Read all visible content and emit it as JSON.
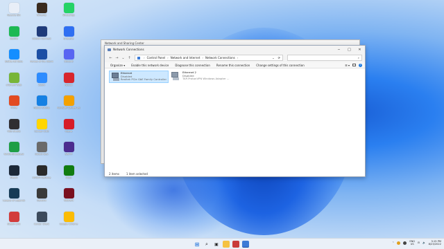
{
  "desktop_icons": [
    {
      "label": "Recycle Bin",
      "icon": "recycle-bin-icon",
      "color": "#e8eef7"
    },
    {
      "label": "Winamp",
      "icon": "winamp-icon",
      "color": "#3a2b1e"
    },
    {
      "label": "WhatsApp",
      "icon": "whatsapp-icon",
      "color": "#25d366"
    },
    {
      "label": "Spotify",
      "icon": "spotify-icon",
      "color": "#1db954"
    },
    {
      "label": "Ubisoft Connect",
      "icon": "ubisoft-icon",
      "color": "#1f3b7a"
    },
    {
      "label": "Snipaste",
      "icon": "snipaste-icon",
      "color": "#2f6ff2"
    },
    {
      "label": "Battle.net Beta",
      "icon": "battlenet-icon",
      "color": "#148eff"
    },
    {
      "label": "Heroes of the Storm",
      "icon": "hots-icon",
      "color": "#1c4fa5"
    },
    {
      "label": "Discord",
      "icon": "discord-icon",
      "color": "#5865f2"
    },
    {
      "label": "uTorrent Web",
      "icon": "utorrent-icon",
      "color": "#77b538"
    },
    {
      "label": "Zoom",
      "icon": "zoom-icon",
      "color": "#2d8cff"
    },
    {
      "label": "Roblox",
      "icon": "roblox-icon",
      "color": "#d8262d"
    },
    {
      "label": "Prime",
      "icon": "prime-icon",
      "color": "#e24a21"
    },
    {
      "label": "Roblox Studio",
      "icon": "roblox-studio-icon",
      "color": "#1580e3"
    },
    {
      "label": "Rockstar Games Launcher",
      "icon": "rockstar-icon",
      "color": "#f4a100"
    },
    {
      "label": "OBS Studio",
      "icon": "obs-icon",
      "color": "#302e31"
    },
    {
      "label": "Corsair iCUE",
      "icon": "icue-icon",
      "color": "#ffd600"
    },
    {
      "label": "Opera",
      "icon": "opera-icon",
      "color": "#d61c28"
    },
    {
      "label": "Nvidia Broadcast",
      "icon": "nvidia-broadcast-icon",
      "color": "#1e9e45"
    },
    {
      "label": "Ublock Dev",
      "icon": "ublock-icon",
      "color": "#6a6a6a"
    },
    {
      "label": "SWI-Pl",
      "icon": "swipl-icon",
      "color": "#4b2c8f"
    },
    {
      "label": "Steam",
      "icon": "steam-icon",
      "color": "#1b2838"
    },
    {
      "label": "NVIDIA GeForce",
      "icon": "nvidia-icon",
      "color": "#2a2a2a"
    },
    {
      "label": "Xbox",
      "icon": "xbox-icon",
      "color": "#107c10"
    },
    {
      "label": "League of Legends",
      "icon": "league-icon",
      "color": "#163b56"
    },
    {
      "label": "Genshin",
      "icon": "genshin-icon",
      "color": "#3a3a3a"
    },
    {
      "label": "Valorant",
      "icon": "valorant-icon",
      "color": "#7a1020"
    },
    {
      "label": "Steam Link",
      "icon": "steam-link-icon",
      "color": "#d23b3b"
    },
    {
      "label": "Cursor Client",
      "icon": "cursor-icon",
      "color": "#3c4a5c"
    },
    {
      "label": "Google Chrome",
      "icon": "chrome-icon",
      "color": "#fbbc05"
    }
  ],
  "back_window": {
    "title": "Network and Sharing Center"
  },
  "window": {
    "title": "Network Connections",
    "controls": {
      "minimize": "─",
      "maximize": "□",
      "close": "✕"
    },
    "nav": {
      "back": "←",
      "forward": "→",
      "recent": "⌄",
      "up": "↑"
    },
    "breadcrumb": [
      "Control Panel",
      "Network and Internet",
      "Network Connections"
    ],
    "search_icon": "⌕",
    "commands": [
      "Organize ▾",
      "Enable this network device",
      "Diagnose this connection",
      "Rename this connection",
      "Change settings of this connection"
    ],
    "items": [
      {
        "name": "Ethernet",
        "status": "Disabled",
        "device": "Realtek PCIe GbE Family Controller",
        "selected": true
      },
      {
        "name": "Ethernet 2",
        "status": "Disabled",
        "device": "TAP-ProtonVPN Windows Adapter ..."
      }
    ],
    "status": {
      "count": "2 items",
      "selected": "1 item selected"
    }
  },
  "taskbar": {
    "icons": [
      "windows-start-icon",
      "search-icon",
      "task-view-icon",
      "file-explorer-icon",
      "app-icon",
      "control-panel-icon"
    ],
    "tray": {
      "lang_top": "ENG",
      "lang_bottom": "US",
      "time": "3:15 PM",
      "date": "8/23/2022"
    }
  }
}
